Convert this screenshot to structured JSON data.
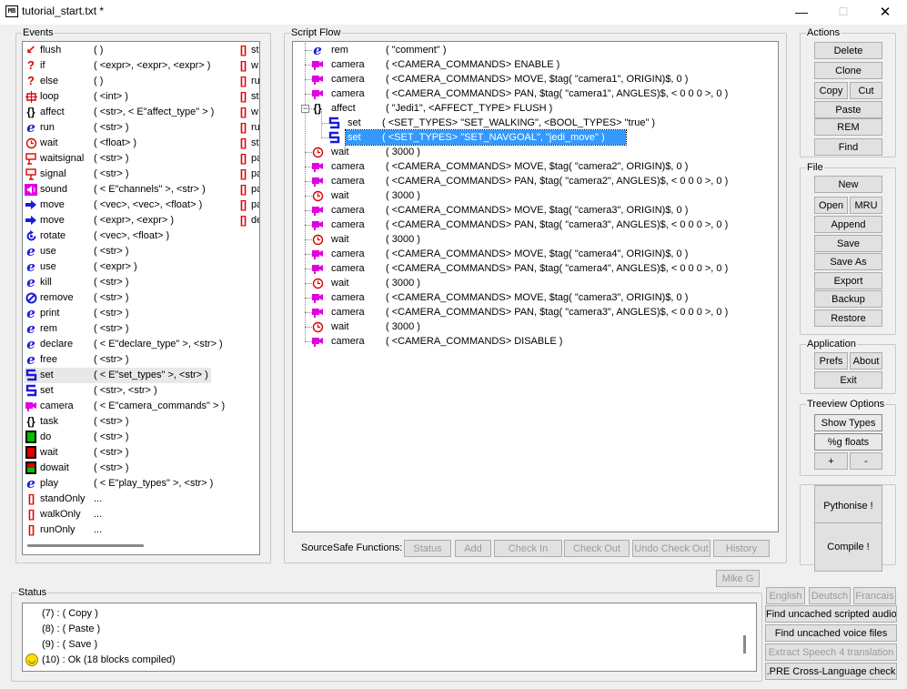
{
  "window": {
    "title": "tutorial_start.txt *",
    "app_icon": "MB",
    "min_glyph": "—",
    "max_glyph": "☐",
    "close_glyph": "✕"
  },
  "events": {
    "label": "Events",
    "items": [
      {
        "icon": "flush-icon",
        "glyph": "✘",
        "name": "flush",
        "args": "(   )"
      },
      {
        "icon": "if-icon",
        "glyph": "?",
        "name": "if",
        "args": "( <expr>, <expr>, <expr> )"
      },
      {
        "icon": "else-icon",
        "glyph": "?",
        "name": "else",
        "args": "(   )"
      },
      {
        "icon": "loop-icon",
        "glyph": "⟲",
        "name": "loop",
        "args": "( <int> )"
      },
      {
        "icon": "braces-icon",
        "glyph": "{}",
        "name": "affect",
        "args": "( <str>, < E\"affect_type\" > )"
      },
      {
        "icon": "e-icon",
        "glyph": "e",
        "name": "run",
        "args": "( <str> )"
      },
      {
        "icon": "clock-icon",
        "glyph": "◷",
        "name": "wait",
        "args": "( <float> )"
      },
      {
        "icon": "waitsignal-icon",
        "glyph": "⚑",
        "name": "waitsignal",
        "args": "( <str> )"
      },
      {
        "icon": "signal-icon",
        "glyph": "⚑",
        "name": "signal",
        "args": "( <str> )"
      },
      {
        "icon": "sound-icon",
        "glyph": "♪",
        "name": "sound",
        "args": "( < E\"channels\" >, <str> )"
      },
      {
        "icon": "arrow-right-icon",
        "glyph": "➡",
        "name": "move",
        "args": "( <vec>, <vec>, <float> )"
      },
      {
        "icon": "arrow-right-icon",
        "glyph": "➡",
        "name": "move",
        "args": "( <expr>, <expr> )"
      },
      {
        "icon": "rotate-icon",
        "glyph": "⟳",
        "name": "rotate",
        "args": "( <vec>, <float> )"
      },
      {
        "icon": "e-icon",
        "glyph": "e",
        "name": "use",
        "args": "( <str> )"
      },
      {
        "icon": "e-icon",
        "glyph": "e",
        "name": "use",
        "args": "( <expr> )"
      },
      {
        "icon": "e-icon",
        "glyph": "e",
        "name": "kill",
        "args": "( <str> )"
      },
      {
        "icon": "no-icon",
        "glyph": "⊘",
        "name": "remove",
        "args": "( <str> )"
      },
      {
        "icon": "e-icon",
        "glyph": "e",
        "name": "print",
        "args": "( <str> )"
      },
      {
        "icon": "e-icon",
        "glyph": "e",
        "name": "rem",
        "args": "( <str> )"
      },
      {
        "icon": "e-icon",
        "glyph": "e",
        "name": "declare",
        "args": "( < E\"declare_type\" >, <str> )"
      },
      {
        "icon": "e-icon",
        "glyph": "e",
        "name": "free",
        "args": "( <str> )"
      },
      {
        "icon": "set-icon",
        "glyph": "S",
        "name": "set",
        "args": "( < E\"set_types\" >, <str> )"
      },
      {
        "icon": "set-icon",
        "glyph": "S",
        "name": "set",
        "args": "( <str>, <str> )"
      },
      {
        "icon": "camera-icon",
        "glyph": "■",
        "name": "camera",
        "args": "( < E\"camera_commands\" > )"
      },
      {
        "icon": "braces-icon",
        "glyph": "{}",
        "name": "task",
        "args": "( <str> )"
      },
      {
        "icon": "do-icon",
        "glyph": "",
        "name": "do",
        "args": "( <str> )"
      },
      {
        "icon": "wait-block-icon",
        "glyph": "",
        "name": "wait",
        "args": "( <str> )"
      },
      {
        "icon": "dowait-icon",
        "glyph": "",
        "name": "dowait",
        "args": "( <str> )"
      },
      {
        "icon": "e-icon",
        "glyph": "e",
        "name": "play",
        "args": "( < E\"play_types\" >, <str> )"
      },
      {
        "icon": "bracket-icon",
        "glyph": "[]",
        "name": "standOnly",
        "args": "..."
      },
      {
        "icon": "bracket-icon",
        "glyph": "[]",
        "name": "walkOnly",
        "args": "..."
      },
      {
        "icon": "bracket-icon",
        "glyph": "[]",
        "name": "runOnly",
        "args": "..."
      }
    ],
    "right_column": [
      "st",
      "w",
      "ru",
      "st",
      "w",
      "ru",
      "st",
      "pa",
      "pa",
      "pa",
      "pa",
      "de"
    ]
  },
  "script_flow": {
    "label": "Script Flow",
    "nodes": [
      {
        "icon": "e-icon",
        "name": "rem",
        "args": "( \"comment\" )",
        "depth": 0
      },
      {
        "icon": "camera-icon",
        "name": "camera",
        "args": "( <CAMERA_COMMANDS> ENABLE )",
        "depth": 0
      },
      {
        "icon": "camera-icon",
        "name": "camera",
        "args": "( <CAMERA_COMMANDS> MOVE, $tag( \"camera1\", ORIGIN)$, 0 )",
        "depth": 0
      },
      {
        "icon": "camera-icon",
        "name": "camera",
        "args": "( <CAMERA_COMMANDS> PAN, $tag( \"camera1\", ANGLES)$, < 0 0 0 >, 0 )",
        "depth": 0
      },
      {
        "icon": "braces-icon",
        "name": "affect",
        "args": "( \"Jedi1\", <AFFECT_TYPE> FLUSH )",
        "depth": 0,
        "expanded": true
      },
      {
        "icon": "set-icon",
        "name": "set",
        "args": "( <SET_TYPES> \"SET_WALKING\", <BOOL_TYPES> \"true\" )",
        "depth": 1
      },
      {
        "icon": "set-icon",
        "name": "set",
        "args": "( <SET_TYPES> \"SET_NAVGOAL\", \"jedi_move\" )",
        "depth": 1,
        "selected": true
      },
      {
        "icon": "clock-icon",
        "name": "wait",
        "args": "( 3000 )",
        "depth": 0
      },
      {
        "icon": "camera-icon",
        "name": "camera",
        "args": "( <CAMERA_COMMANDS> MOVE, $tag( \"camera2\", ORIGIN)$, 0 )",
        "depth": 0
      },
      {
        "icon": "camera-icon",
        "name": "camera",
        "args": "( <CAMERA_COMMANDS> PAN, $tag( \"camera2\", ANGLES)$, < 0 0 0 >, 0 )",
        "depth": 0
      },
      {
        "icon": "clock-icon",
        "name": "wait",
        "args": "( 3000 )",
        "depth": 0
      },
      {
        "icon": "camera-icon",
        "name": "camera",
        "args": "( <CAMERA_COMMANDS> MOVE, $tag( \"camera3\", ORIGIN)$, 0 )",
        "depth": 0
      },
      {
        "icon": "camera-icon",
        "name": "camera",
        "args": "( <CAMERA_COMMANDS> PAN, $tag( \"camera3\", ANGLES)$, < 0 0 0 >, 0 )",
        "depth": 0
      },
      {
        "icon": "clock-icon",
        "name": "wait",
        "args": "( 3000 )",
        "depth": 0
      },
      {
        "icon": "camera-icon",
        "name": "camera",
        "args": "( <CAMERA_COMMANDS> MOVE, $tag( \"camera4\", ORIGIN)$, 0 )",
        "depth": 0
      },
      {
        "icon": "camera-icon",
        "name": "camera",
        "args": "( <CAMERA_COMMANDS> PAN, $tag( \"camera4\", ANGLES)$, < 0 0 0 >, 0 )",
        "depth": 0
      },
      {
        "icon": "clock-icon",
        "name": "wait",
        "args": "( 3000 )",
        "depth": 0
      },
      {
        "icon": "camera-icon",
        "name": "camera",
        "args": "( <CAMERA_COMMANDS> MOVE, $tag( \"camera3\", ORIGIN)$, 0 )",
        "depth": 0
      },
      {
        "icon": "camera-icon",
        "name": "camera",
        "args": "( <CAMERA_COMMANDS> PAN, $tag( \"camera3\", ANGLES)$, < 0 0 0 >, 0 )",
        "depth": 0
      },
      {
        "icon": "clock-icon",
        "name": "wait",
        "args": "( 3000 )",
        "depth": 0
      },
      {
        "icon": "camera-icon",
        "name": "camera",
        "args": "( <CAMERA_COMMANDS> DISABLE )",
        "depth": 0
      }
    ],
    "sourcesafe_label": "SourceSafe Functions:",
    "sourcesafe_buttons": [
      "Status",
      "Add",
      "Check In",
      "Check Out",
      "Undo Check Out",
      "History"
    ]
  },
  "actions": {
    "label": "Actions",
    "delete": "Delete",
    "clone": "Clone",
    "copy": "Copy",
    "cut": "Cut",
    "paste": "Paste",
    "rem": "REM",
    "find": "Find"
  },
  "file": {
    "label": "File",
    "new": "New",
    "open": "Open",
    "mru": "MRU",
    "append": "Append",
    "save": "Save",
    "save_as": "Save As",
    "export": "Export",
    "backup": "Backup",
    "restore": "Restore"
  },
  "application": {
    "label": "Application",
    "prefs": "Prefs",
    "about": "About",
    "exit": "Exit"
  },
  "treeview_options": {
    "label": "Treeview Options",
    "show_types": "Show Types",
    "g_floats": "%g floats",
    "plus": "+",
    "minus": "-"
  },
  "pythonise": "Pythonise !",
  "compile": "Compile !",
  "user_button": "Mike G",
  "status": {
    "label": "Status",
    "lines": [
      "(7) : ( Copy )",
      "(8) : ( Paste )",
      "(9) : ( Save )",
      "(10) : Ok   (18 blocks compiled)"
    ]
  },
  "languages": [
    "English",
    "Deutsch",
    "Francais"
  ],
  "tools": {
    "uncached_audio": "Find uncached scripted audio",
    "uncached_voice": "Find uncached voice files",
    "extract_speech": "Extract Speech 4 translation",
    "pre_check": ".PRE Cross-Language check"
  }
}
